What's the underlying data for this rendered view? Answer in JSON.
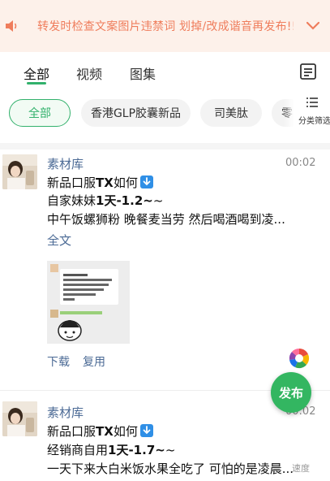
{
  "notice": {
    "text": "转发时检查文案图片违禁词 划掉/改成谐音再发布!!!!!!...",
    "colors": {
      "background": "#fdf1ea",
      "text": "#ef7d5c"
    },
    "icons": {
      "left": "speaker-icon",
      "right": "chevron-down-icon"
    }
  },
  "tabs": [
    {
      "label": "全部",
      "active": true
    },
    {
      "label": "视频",
      "active": false
    },
    {
      "label": "图集",
      "active": false
    }
  ],
  "chips": [
    {
      "label": "全部",
      "active": true
    },
    {
      "label": "香港GLP胶囊新品",
      "active": false
    },
    {
      "label": "司美肽",
      "active": false
    },
    {
      "label": "零",
      "active": false
    }
  ],
  "filter_label": "分类筛选",
  "posts": [
    {
      "author": "素材库",
      "time": "00:02",
      "title_prefix": "新品口服",
      "title_bold": "TX",
      "title_suffix": "如何",
      "line2_prefix": "自家妹妹",
      "line2_bold": "1天-1.2~",
      "line2_suffix": "~",
      "line3": "中午饭螺狮粉 晚餐麦当劳 然后喝酒喝到凌...",
      "full_text": "全文",
      "download": "下载",
      "copy": "复用"
    },
    {
      "author": "素材库",
      "time": "00:02",
      "title_prefix": "新品口服",
      "title_bold": "TX",
      "title_suffix": "如何",
      "line2_prefix": "经销商自用",
      "line2_bold": "1天-1.7~",
      "line2_suffix": "~",
      "line3": "一天下来大白米饭水果全吃了 可怕的是凌晨..."
    }
  ],
  "publish_label": "发布",
  "fade_label": "速度",
  "accent_color": "#32b16c",
  "link_color": "#4b6a95"
}
